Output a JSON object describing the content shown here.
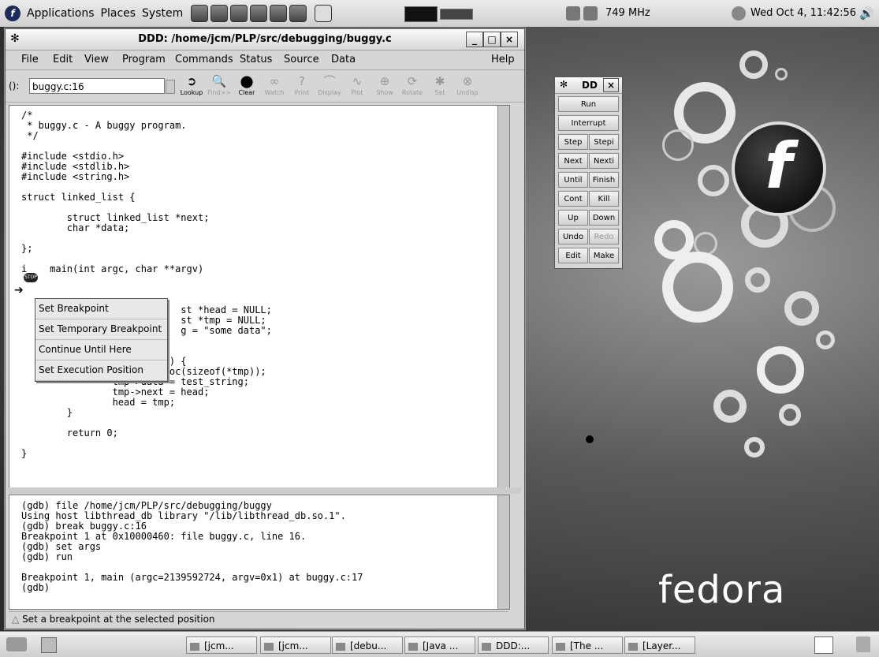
{
  "top_panel": {
    "menus": [
      "Applications",
      "Places",
      "System"
    ],
    "cpu_freq": "749 MHz",
    "clock": "Wed Oct  4, 11:42:56"
  },
  "desktop": {
    "brand": "fedora"
  },
  "ddd": {
    "title": "DDD: /home/jcm/PLP/src/debugging/buggy.c",
    "menu": [
      "File",
      "Edit",
      "View",
      "Program",
      "Commands",
      "Status",
      "Source",
      "Data",
      "Help"
    ],
    "arg_label": "():",
    "arg_value": "buggy.c:16",
    "tools": [
      {
        "label": "Lookup",
        "icon": "lookup-icon",
        "enabled": true
      },
      {
        "label": "Find>>",
        "icon": "find-icon",
        "enabled": false
      },
      {
        "label": "Clear",
        "icon": "stop-icon",
        "enabled": true
      },
      {
        "label": "Watch",
        "icon": "watch-icon",
        "enabled": false
      },
      {
        "label": "Print",
        "icon": "print-icon",
        "enabled": false
      },
      {
        "label": "Display",
        "icon": "display-icon",
        "enabled": false
      },
      {
        "label": "Plot",
        "icon": "plot-icon",
        "enabled": false
      },
      {
        "label": "Show",
        "icon": "show-icon",
        "enabled": false
      },
      {
        "label": "Rotate",
        "icon": "rotate-icon",
        "enabled": false
      },
      {
        "label": "Set",
        "icon": "set-icon",
        "enabled": false
      },
      {
        "label": "Undisp",
        "icon": "undisp-icon",
        "enabled": false
      }
    ],
    "source_lines": [
      "/*",
      " * buggy.c - A buggy program.",
      " */",
      "",
      "#include <stdio.h>",
      "#include <stdlib.h>",
      "#include <string.h>",
      "",
      "struct linked_list {",
      "",
      "        struct linked_list *next;",
      "        char *data;",
      "",
      "};",
      "",
      "i    main(int argc, char **argv)",
      "",
      "",
      "",
      "                            st *head = NULL;",
      "                            st *tmp = NULL;",
      "                            g = \"some data\";",
      "",
      "",
      "                         +) {",
      "                tmp = malloc(sizeof(*tmp));",
      "                tmp->data = test_string;",
      "                tmp->next = head;",
      "                head = tmp;",
      "        }",
      "",
      "        return 0;",
      "",
      "}"
    ],
    "context_menu": [
      "Set Breakpoint",
      "Set Temporary Breakpoint",
      "Continue Until Here",
      "Set Execution Position"
    ],
    "gdb_lines": [
      "(gdb) file /home/jcm/PLP/src/debugging/buggy",
      "Using host libthread_db library \"/lib/libthread_db.so.1\".",
      "(gdb) break buggy.c:16",
      "Breakpoint 1 at 0x10000460: file buggy.c, line 16.",
      "(gdb) set args",
      "(gdb) run",
      "",
      "Breakpoint 1, main (argc=2139592724, argv=0x1) at buggy.c:17",
      "(gdb)"
    ],
    "status": "Set a breakpoint at the selected position"
  },
  "command_tool": {
    "title": "DD",
    "buttons": [
      {
        "label": "Run",
        "enabled": true
      },
      {
        "label": "Interrupt",
        "enabled": true
      },
      {
        "label": "Step",
        "enabled": true
      },
      {
        "label": "Stepi",
        "enabled": true
      },
      {
        "label": "Next",
        "enabled": true
      },
      {
        "label": "Nexti",
        "enabled": true
      },
      {
        "label": "Until",
        "enabled": true
      },
      {
        "label": "Finish",
        "enabled": true
      },
      {
        "label": "Cont",
        "enabled": true
      },
      {
        "label": "Kill",
        "enabled": true
      },
      {
        "label": "Up",
        "enabled": true
      },
      {
        "label": "Down",
        "enabled": true
      },
      {
        "label": "Undo",
        "enabled": true
      },
      {
        "label": "Redo",
        "enabled": false
      },
      {
        "label": "Edit",
        "enabled": true
      },
      {
        "label": "Make",
        "enabled": true
      }
    ]
  },
  "taskbar": [
    {
      "label": "[jcm...",
      "icon": "terminal-icon"
    },
    {
      "label": "[jcm...",
      "icon": "terminal-icon"
    },
    {
      "label": "[debu...",
      "icon": "document-icon"
    },
    {
      "label": "[Java ...",
      "icon": "java-icon"
    },
    {
      "label": "DDD:...",
      "icon": "ddd-icon"
    },
    {
      "label": "[The ...",
      "icon": "gimp-icon"
    },
    {
      "label": "[Layer...",
      "icon": "gimp-icon"
    }
  ]
}
